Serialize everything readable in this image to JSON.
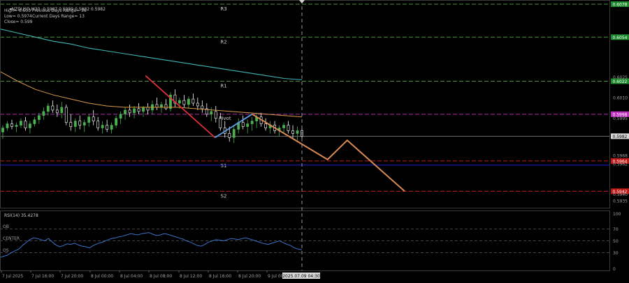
{
  "info": {
    "symbol_line": "NZDUSD,M30  0.5987 0.5989 0.5982 0.5982",
    "high_label": "High= 0.603",
    "prev_range_label": "Previous Days Range= 56",
    "low_label": "Low= 0.5974",
    "curr_range_label": "Current Days Range= 13",
    "close_label": "Close= 0.599"
  },
  "colors": {
    "background": "#000000",
    "bull_candle": "#4caf50",
    "bear_candle": "#ffffff",
    "ma_cyan": "#3fb7b4",
    "ma_orange": "#d99a4a",
    "red_leg": "#e0303a",
    "blue_leg": "#5aa0e8",
    "projection": "#d88a55",
    "level_green": "#4c8f3c",
    "level_magenta": "#b030b0",
    "level_red": "#c02020",
    "level_blue": "#1a1ab8",
    "rsi_line": "#3a74c8"
  },
  "chart_data": [
    {
      "type": "candlestick",
      "title": "NZDUSD,M30",
      "y_ticks": [
        "0.6078",
        "0.6054",
        "0.6025",
        "0.6022",
        "0.6010",
        "0.5995",
        "0.5968",
        "0.5962",
        "0.5940",
        "0.5935"
      ],
      "ylim": [
        0.593,
        0.608
      ],
      "levels": [
        {
          "name": "R3",
          "value": 0.6078,
          "price_label": "0.6078",
          "style": "green"
        },
        {
          "name": "R2",
          "value": 0.6054,
          "price_label": "0.6054",
          "style": "green"
        },
        {
          "name": "R1",
          "value": 0.6022,
          "price_label": "0.6022",
          "style": "green"
        },
        {
          "name": "Pivot",
          "value": 0.5998,
          "price_label": "0.5998",
          "style": "magenta"
        },
        {
          "name": "S1",
          "value": 0.5964,
          "price_label": "0.5964",
          "style": "red"
        },
        {
          "name": "S2",
          "value": 0.5942,
          "price_label": "0.5942",
          "style": "red"
        }
      ],
      "current_price": {
        "value": 0.5982,
        "label": "0.5982"
      },
      "blue_line": 0.5961,
      "x_ticks": [
        "7 Jul 2025",
        "7 Jul 16:00",
        "7 Jul 20:00",
        "8 Jul 00:00",
        "8 Jul 04:00",
        "8 Jul 08:00",
        "8 Jul 12:00",
        "8 Jul 16:00",
        "8 Jul 20:00",
        "9 Jul 00:",
        "2025.07.09 04:30"
      ],
      "candles": [
        [
          0.5985,
          0.599,
          0.598,
          0.5988
        ],
        [
          0.5988,
          0.5993,
          0.5986,
          0.5991
        ],
        [
          0.5991,
          0.5994,
          0.5987,
          0.5989
        ],
        [
          0.5989,
          0.5992,
          0.5985,
          0.599
        ],
        [
          0.599,
          0.5995,
          0.5988,
          0.5993
        ],
        [
          0.5993,
          0.5996,
          0.5986,
          0.5988
        ],
        [
          0.5988,
          0.5993,
          0.5984,
          0.5991
        ],
        [
          0.5991,
          0.5996,
          0.5989,
          0.5994
        ],
        [
          0.5994,
          0.5999,
          0.5991,
          0.5997
        ],
        [
          0.5997,
          0.6003,
          0.5994,
          0.6
        ],
        [
          0.6,
          0.6006,
          0.5997,
          0.6004
        ],
        [
          0.6004,
          0.6008,
          0.5999,
          0.6001
        ],
        [
          0.6001,
          0.6005,
          0.5996,
          0.5999
        ],
        [
          0.5999,
          0.6007,
          0.5995,
          0.6003
        ],
        [
          0.6003,
          0.6005,
          0.599,
          0.5992
        ],
        [
          0.5992,
          0.5998,
          0.5986,
          0.5989
        ],
        [
          0.5989,
          0.5995,
          0.5985,
          0.5993
        ],
        [
          0.5993,
          0.5997,
          0.5987,
          0.599
        ],
        [
          0.599,
          0.5994,
          0.5985,
          0.5992
        ],
        [
          0.5992,
          0.5998,
          0.5989,
          0.5996
        ],
        [
          0.5996,
          0.6001,
          0.599,
          0.5993
        ],
        [
          0.5993,
          0.5996,
          0.5986,
          0.5988
        ],
        [
          0.5988,
          0.5993,
          0.5984,
          0.599
        ],
        [
          0.599,
          0.5994,
          0.5985,
          0.5987
        ],
        [
          0.5987,
          0.5992,
          0.5984,
          0.599
        ],
        [
          0.599,
          0.5997,
          0.5988,
          0.5995
        ],
        [
          0.5995,
          0.6,
          0.5991,
          0.5998
        ],
        [
          0.5998,
          0.6003,
          0.5994,
          0.6001
        ],
        [
          0.6001,
          0.6005,
          0.5996,
          0.5999
        ],
        [
          0.5999,
          0.6004,
          0.5995,
          0.6002
        ],
        [
          0.6002,
          0.6006,
          0.5998,
          0.6
        ],
        [
          0.6,
          0.6004,
          0.5996,
          0.6003
        ],
        [
          0.6003,
          0.6006,
          0.5998,
          0.6001
        ],
        [
          0.6001,
          0.6008,
          0.5998,
          0.6005
        ],
        [
          0.6005,
          0.601,
          0.6001,
          0.6003
        ],
        [
          0.6003,
          0.6007,
          0.5999,
          0.6005
        ],
        [
          0.6005,
          0.6009,
          0.6001,
          0.6002
        ],
        [
          0.6002,
          0.6014,
          0.6,
          0.6012
        ],
        [
          0.6012,
          0.6016,
          0.6003,
          0.6006
        ],
        [
          0.6006,
          0.601,
          0.6002,
          0.6008
        ],
        [
          0.6008,
          0.6012,
          0.6003,
          0.6005
        ],
        [
          0.6005,
          0.6011,
          0.6002,
          0.6009
        ],
        [
          0.6009,
          0.6013,
          0.6004,
          0.6006
        ],
        [
          0.6006,
          0.601,
          0.6001,
          0.6004
        ],
        [
          0.6004,
          0.6008,
          0.5999,
          0.6002
        ],
        [
          0.6002,
          0.6006,
          0.5996,
          0.5998
        ],
        [
          0.5998,
          0.6003,
          0.5993,
          0.6
        ],
        [
          0.6,
          0.6004,
          0.5992,
          0.5995
        ],
        [
          0.5995,
          0.5999,
          0.5986,
          0.5988
        ],
        [
          0.5988,
          0.5993,
          0.5981,
          0.5984
        ],
        [
          0.5984,
          0.5989,
          0.5978,
          0.5981
        ],
        [
          0.5981,
          0.599,
          0.5977,
          0.5987
        ],
        [
          0.5987,
          0.5995,
          0.5984,
          0.5992
        ],
        [
          0.5992,
          0.5997,
          0.5987,
          0.5989
        ],
        [
          0.5989,
          0.5994,
          0.5984,
          0.5991
        ],
        [
          0.5991,
          0.5996,
          0.5986,
          0.5993
        ],
        [
          0.5993,
          0.5999,
          0.5988,
          0.5996
        ],
        [
          0.5996,
          0.5999,
          0.5989,
          0.5991
        ],
        [
          0.5991,
          0.5995,
          0.5986,
          0.5988
        ],
        [
          0.5988,
          0.5993,
          0.5984,
          0.599
        ],
        [
          0.599,
          0.5993,
          0.5984,
          0.5986
        ],
        [
          0.5986,
          0.599,
          0.5982,
          0.5988
        ],
        [
          0.5988,
          0.5992,
          0.5984,
          0.599
        ],
        [
          0.599,
          0.5993,
          0.5984,
          0.5986
        ],
        [
          0.5986,
          0.599,
          0.598,
          0.5984
        ],
        [
          0.5984,
          0.5989,
          0.5979,
          0.5986
        ],
        [
          0.5986,
          0.5988,
          0.598,
          0.5982
        ]
      ],
      "ma_cyan": [
        0.606,
        0.6057,
        0.6054,
        0.6051,
        0.6049,
        0.6046,
        0.6044,
        0.6042,
        0.604,
        0.6038,
        0.6036,
        0.6034,
        0.6032,
        0.603,
        0.6028,
        0.6026,
        0.6024,
        0.6023
      ],
      "ma_orange": [
        0.6029,
        0.6022,
        0.6016,
        0.6012,
        0.6009,
        0.6006,
        0.6004,
        0.6003,
        0.6003,
        0.6003,
        0.6003,
        0.6002,
        0.6001,
        0.6,
        0.5999,
        0.5998,
        0.5997,
        0.5996
      ],
      "overlay_zigzag": [
        {
          "x": 0.482,
          "y": 0.6026
        },
        {
          "x": 0.712,
          "y": 0.5981
        },
        {
          "x": 0.835,
          "y": 0.5998
        }
      ],
      "projection": [
        {
          "x": 0.835,
          "y": 0.5998
        },
        {
          "x": 1.085,
          "y": 0.5965
        },
        {
          "x": 1.15,
          "y": 0.5979
        },
        {
          "x": 1.34,
          "y": 0.5942
        }
      ]
    },
    {
      "type": "line",
      "title": "RSI(14) 35.4278",
      "ylim": [
        0,
        100
      ],
      "y_ticks": [
        "100",
        "70",
        "50",
        "30",
        "0"
      ],
      "levels": [
        {
          "name": "OB",
          "value": 70
        },
        {
          "name": "CENTER",
          "value": 50
        },
        {
          "name": "OS",
          "value": 30
        }
      ],
      "values": [
        22,
        24,
        26,
        30,
        33,
        36,
        42,
        47,
        52,
        55,
        54,
        52,
        50,
        54,
        48,
        43,
        40,
        42,
        45,
        44,
        46,
        43,
        41,
        40,
        38,
        42,
        45,
        47,
        49,
        52,
        54,
        55,
        57,
        58,
        60,
        62,
        61,
        60,
        62,
        63,
        64,
        61,
        59,
        60,
        62,
        61,
        59,
        57,
        55,
        53,
        50,
        48,
        45,
        42,
        41,
        44,
        48,
        50,
        52,
        51,
        50,
        52,
        54,
        53,
        52,
        54,
        55,
        53,
        51,
        49,
        47,
        45,
        44,
        46,
        48,
        50,
        47,
        44,
        42,
        38,
        36,
        35
      ]
    }
  ]
}
